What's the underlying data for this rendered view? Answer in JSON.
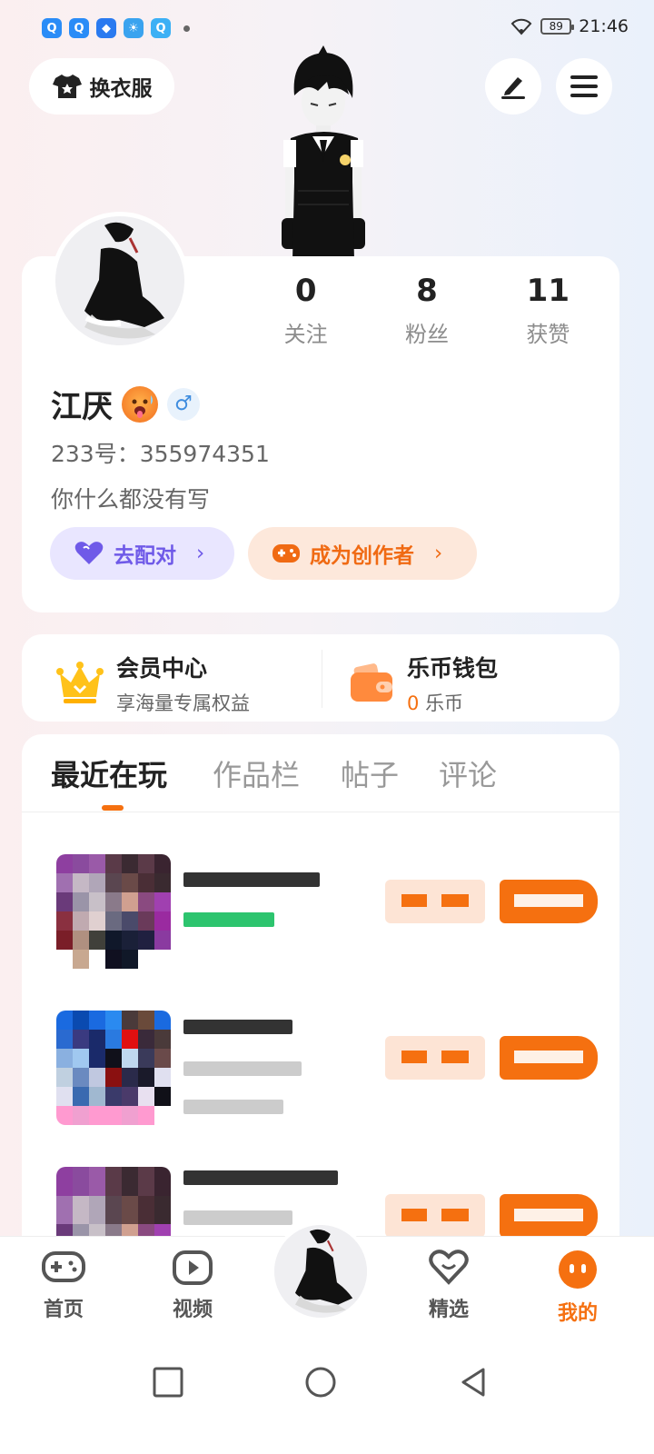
{
  "status_bar": {
    "time": "21:46",
    "battery": "89",
    "app_icons": [
      {
        "name": "qq-icon",
        "color": "#2a8cf7"
      },
      {
        "name": "qq-icon",
        "color": "#2a8cf7"
      },
      {
        "name": "shield-app-icon",
        "color": "#2a7af0"
      },
      {
        "name": "weather-app-icon",
        "color": "#3aa3ef"
      },
      {
        "name": "qq-icon",
        "color": "#3cb0f5"
      }
    ]
  },
  "header": {
    "outfit_label": "换衣服"
  },
  "profile": {
    "stats": [
      {
        "value": "0",
        "label": "关注"
      },
      {
        "value": "8",
        "label": "粉丝"
      },
      {
        "value": "11",
        "label": "获赞"
      }
    ],
    "name": "江厌",
    "gender_symbol": "♂",
    "id_text": "233号：355974351",
    "bio": "你什么都没有写",
    "match_label": "去配对",
    "creator_label": "成为创作者"
  },
  "member": {
    "vip_title": "会员中心",
    "vip_sub": "享海量专属权益",
    "wallet_title": "乐币钱包",
    "wallet_value": "0",
    "wallet_unit": "乐币"
  },
  "tabs": [
    "最近在玩",
    "作品栏",
    "帖子",
    "评论"
  ],
  "bottom_nav": [
    "首页",
    "视频",
    "精选",
    "我的"
  ],
  "colors": {
    "accent": "#f57010",
    "purple": "#6f5ae8"
  }
}
